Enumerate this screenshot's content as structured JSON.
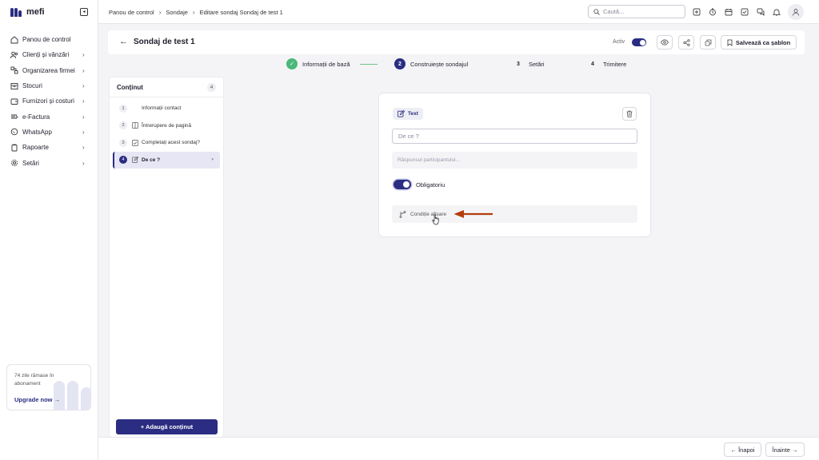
{
  "app": {
    "logo_text": "mefi"
  },
  "sidebar": {
    "items": [
      {
        "label": "Panou de control",
        "icon": "home-icon",
        "chevron": ""
      },
      {
        "label": "Clienți și vânzări",
        "icon": "users-icon",
        "chevron": "›"
      },
      {
        "label": "Organizarea firmei",
        "icon": "org-icon",
        "chevron": "›"
      },
      {
        "label": "Stocuri",
        "icon": "box-icon",
        "chevron": "›"
      },
      {
        "label": "Furnizori și costuri",
        "icon": "wallet-icon",
        "chevron": "›"
      },
      {
        "label": "e-Factura",
        "icon": "efactura-icon",
        "chevron": "›"
      },
      {
        "label": "WhatsApp",
        "icon": "whatsapp-icon",
        "chevron": "›"
      },
      {
        "label": "Rapoarte",
        "icon": "report-icon",
        "chevron": "›"
      },
      {
        "label": "Setări",
        "icon": "gear-icon",
        "chevron": "›"
      }
    ],
    "upgrade": {
      "text": "74 zile rămase în abonament",
      "link": "Upgrade now →"
    }
  },
  "topbar": {
    "breadcrumbs": [
      "Panou de control",
      "Sondaje",
      "Editare sondaj Sondaj de test 1"
    ],
    "separator": "›",
    "search_placeholder": "Caută..."
  },
  "header": {
    "title": "Sondaj de test 1",
    "back": "←",
    "active_label": "Activ",
    "save_template": "Salvează ca șablon"
  },
  "stepper": {
    "steps": [
      {
        "num": "✓",
        "label": "Informații de bază"
      },
      {
        "num": "2",
        "label": "Construiește sondajul"
      },
      {
        "num": "3",
        "label": "Setări"
      },
      {
        "num": "4",
        "label": "Trimitere"
      }
    ]
  },
  "content_panel": {
    "title": "Conținut",
    "count": "4",
    "items": [
      {
        "num": "1",
        "label": "Informații contact"
      },
      {
        "num": "2",
        "label": "Întrerupere de pagină"
      },
      {
        "num": "3",
        "label": "Completați acest sondaj?"
      },
      {
        "num": "4",
        "label": "De ce ?"
      }
    ],
    "add_button": "+ Adaugă conținut"
  },
  "question": {
    "type": "Text",
    "question_text": "De ce ?",
    "answer_placeholder": "Răspunsul participantului...",
    "required_label": "Obligatoriu",
    "condition_label": "Condiție afișare"
  },
  "footer": {
    "back": "← Înapoi",
    "next": "Înainte →"
  },
  "colors": {
    "primary": "#2b2d82",
    "success": "#4cb87a",
    "annotation": "#b43c0c"
  }
}
